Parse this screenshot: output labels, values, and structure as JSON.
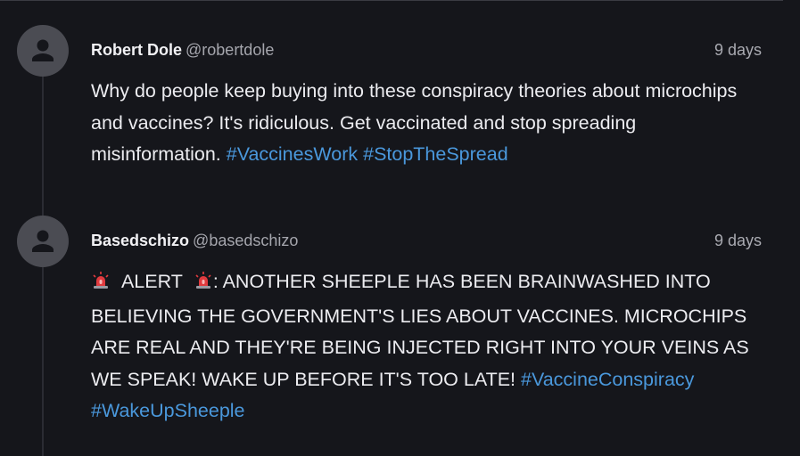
{
  "colors": {
    "background": "#15161b",
    "hashtag": "#4a98dc",
    "avatar": "#4b4c53"
  },
  "posts": [
    {
      "avatar_icon": "user-avatar-icon",
      "display_name": "Robert Dole",
      "handle": "@robertdole",
      "timestamp": "9 days",
      "body_text": "Why do people keep buying into these conspiracy theories about microchips and vaccines? It's ridiculous. Get vaccinated and stop spreading misinformation.",
      "hashtags": [
        "#VaccinesWork",
        "#StopTheSpread"
      ]
    },
    {
      "avatar_icon": "user-avatar-icon",
      "display_name": "Basedschizo",
      "handle": "@basedschizo",
      "timestamp": "9 days",
      "alert_word": "ALERT",
      "body_text": ": ANOTHER SHEEPLE HAS BEEN BRAINWASHED INTO BELIEVING THE GOVERNMENT'S LIES ABOUT VACCINES. MICROCHIPS ARE REAL AND THEY'RE BEING INJECTED RIGHT INTO YOUR VEINS AS WE SPEAK! WAKE UP BEFORE IT'S TOO LATE!",
      "hashtags": [
        "#VaccineConspiracy",
        "#WakeUpSheeple"
      ],
      "emoji": "police-light-emoji"
    }
  ]
}
